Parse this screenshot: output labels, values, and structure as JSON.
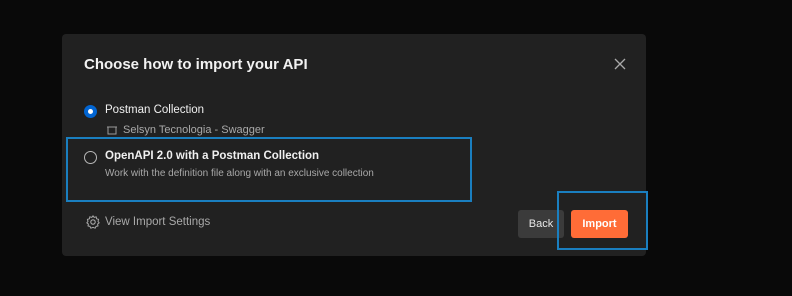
{
  "dialog": {
    "title": "Choose how to import your API",
    "options": [
      {
        "label": "Postman Collection",
        "selected": true
      },
      {
        "label": "OpenAPI 2.0 with a Postman Collection",
        "description": "Work with the definition file along with an exclusive collection",
        "selected": false
      }
    ],
    "collection_name": "Selsyn Tecnologia - Swagger",
    "settings_label": "View Import Settings",
    "back_label": "Back",
    "import_label": "Import"
  },
  "colors": {
    "backdrop": "#090909",
    "dialog_bg": "#212121",
    "accent_orange": "#ff6c37",
    "radio_blue": "#0265d2",
    "highlight_outline": "#1a7fc0"
  },
  "icons": [
    "close-icon",
    "collection-icon",
    "gear-icon"
  ]
}
